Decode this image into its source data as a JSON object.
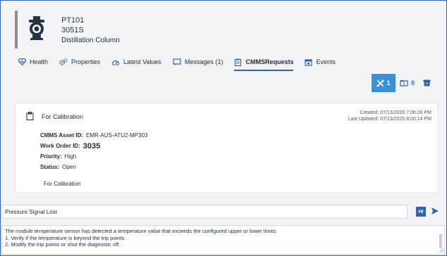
{
  "device": {
    "tag": "PT101",
    "model": "3051S",
    "unit": "Distillation Column",
    "icon": "pressure-transmitter-icon"
  },
  "tabs": [
    {
      "label": "Health",
      "icon": "heart-pulse-icon",
      "active": false
    },
    {
      "label": "Properties",
      "icon": "gears-icon",
      "active": false
    },
    {
      "label": "Latest Values",
      "icon": "gauge-icon",
      "active": false
    },
    {
      "label": "Messages (1)",
      "icon": "message-icon",
      "active": false
    },
    {
      "label": "CMMSRequests",
      "icon": "clipboard-icon",
      "active": true
    },
    {
      "label": "Events",
      "icon": "calendar-icon",
      "active": false
    }
  ],
  "toolbar": {
    "tools_count": "1",
    "folders_count": "0",
    "accent": "#3d8fd6"
  },
  "request": {
    "title": "For Calibration",
    "created": "Created: 07/13/2020 7:06:26 PM",
    "updated": "Last Updated: 07/13/2020 8:00:14 PM",
    "asset_label": "CMMS Asset ID:",
    "asset_value": "EMR-AUS-ATU2-MP303",
    "work_order_label": "Work Order ID:",
    "work_order_value": "3035",
    "priority_label": "Priority:",
    "priority_value": "High",
    "status_label": "Status:",
    "status_value": "Open",
    "description": "For Calibration"
  },
  "issue": {
    "value": "Pressure Signal Lost",
    "hi_label": "HI"
  },
  "message": {
    "line1": "The module temperature sensor has detected a temperature value that exceeds the configured upper or lower limits.",
    "line2": "1. Verify if the temperature is beyond the trip points.",
    "line3": "2. Modify the trip points or shut the diagnostic off."
  },
  "colors": {
    "brand": "#2f63b6",
    "background": "#f3f4f6"
  }
}
